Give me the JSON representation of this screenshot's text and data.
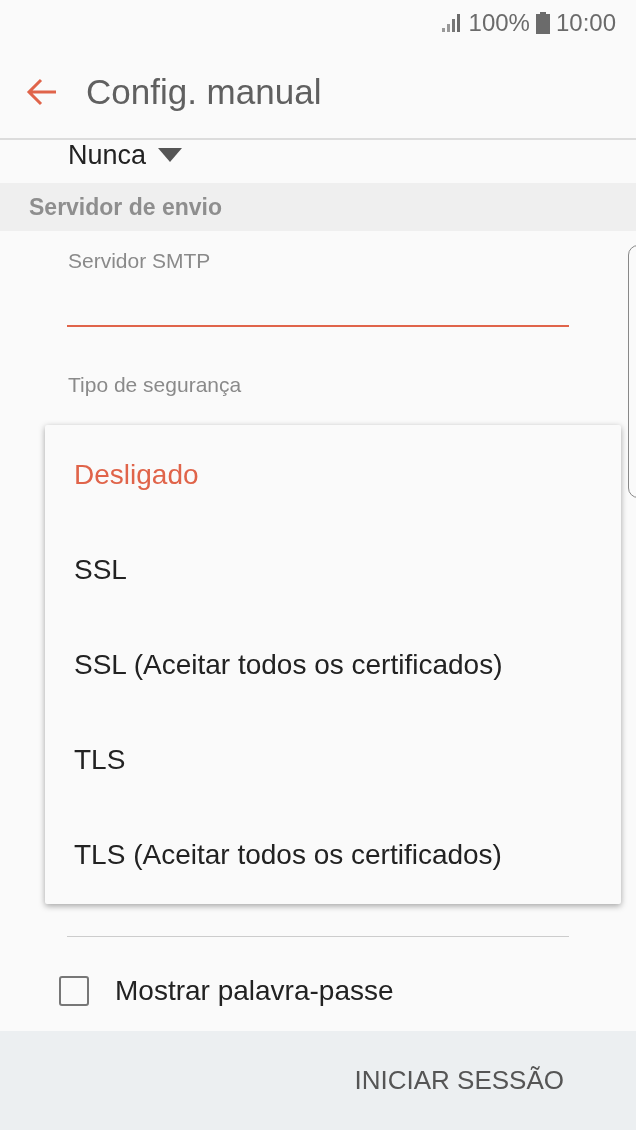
{
  "status_bar": {
    "battery": "100%",
    "time": "10:00"
  },
  "app_bar": {
    "title": "Config. manual"
  },
  "sync_dropdown": {
    "value": "Nunca"
  },
  "section": {
    "title": "Servidor de envio"
  },
  "smtp_field": {
    "label": "Servidor SMTP",
    "focused": true
  },
  "security_field": {
    "label": "Tipo de segurança"
  },
  "security_menu": [
    {
      "label": "Desligado",
      "selected": true
    },
    {
      "label": "SSL",
      "selected": false
    },
    {
      "label": "SSL (Aceitar todos os certificados)",
      "selected": false
    },
    {
      "label": "TLS",
      "selected": false
    },
    {
      "label": "TLS (Aceitar todos os certificados)",
      "selected": false
    }
  ],
  "show_password": {
    "label": "Mostrar palavra-passe",
    "checked": false
  },
  "sign_in_button": {
    "label": "INICIAR SESSÃO"
  }
}
